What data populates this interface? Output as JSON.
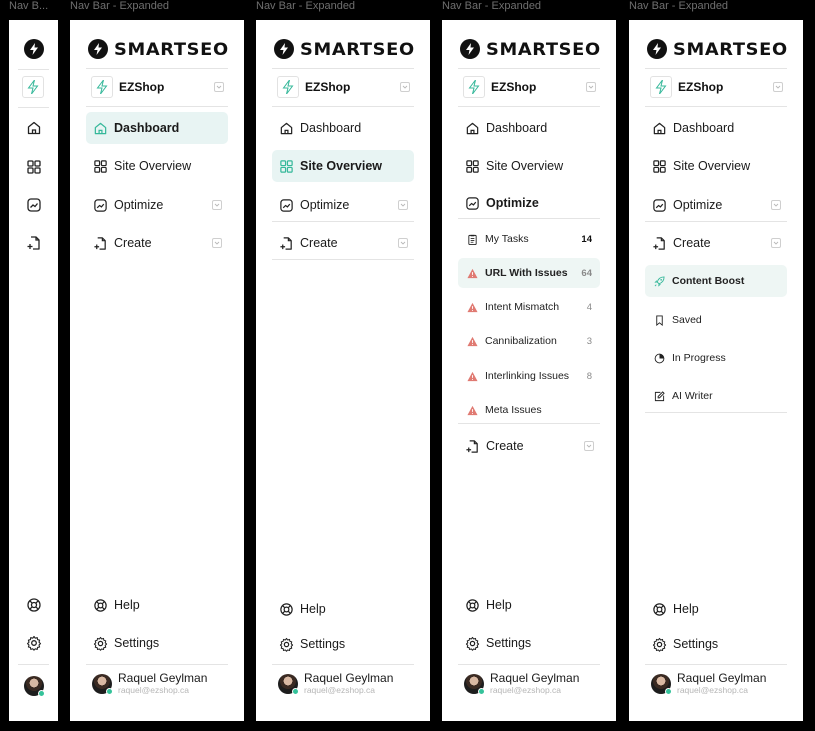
{
  "frames": {
    "collapsed_label": "Nav B...",
    "expanded_label": "Nav Bar - Expanded"
  },
  "brand": {
    "name": "SMARTSEO"
  },
  "shop": {
    "name": "EZShop"
  },
  "nav": {
    "dashboard": "Dashboard",
    "site_overview": "Site Overview",
    "optimize": "Optimize",
    "create": "Create"
  },
  "optimize_sub": [
    {
      "label": "My Tasks",
      "count": "14"
    },
    {
      "label": "URL With Issues",
      "count": "64"
    },
    {
      "label": "Intent Mismatch",
      "count": "4"
    },
    {
      "label": "Cannibalization",
      "count": "3"
    },
    {
      "label": "Interlinking Issues",
      "count": "8"
    },
    {
      "label": "Meta Issues",
      "count": ""
    }
  ],
  "create_sub": [
    {
      "label": "Content Boost"
    },
    {
      "label": "Saved"
    },
    {
      "label": "In Progress"
    },
    {
      "label": "AI Writer"
    }
  ],
  "footer": {
    "help": "Help",
    "settings": "Settings"
  },
  "user": {
    "name": "Raquel Geylman",
    "email": "raquel@ezshop.ca"
  },
  "colors": {
    "accent_teal": "#35b89a",
    "active_bg": "#e8f4f3",
    "warning_red": "#e07a72",
    "online_green": "#34c29a"
  }
}
